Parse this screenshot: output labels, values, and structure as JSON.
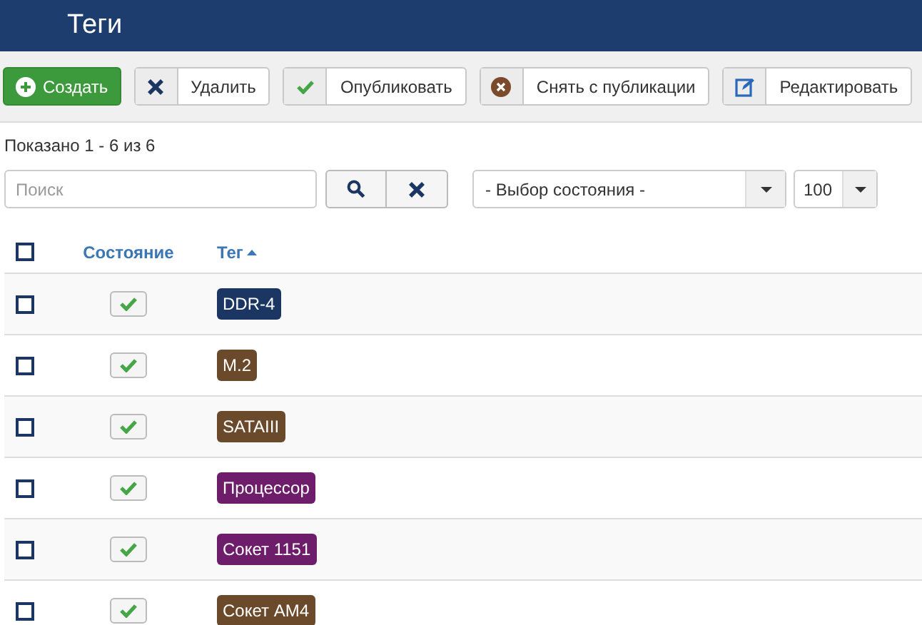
{
  "header": {
    "title": "Теги"
  },
  "toolbar": [
    {
      "kind": "create",
      "label": "Создать"
    },
    {
      "kind": "delete",
      "label": "Удалить"
    },
    {
      "kind": "publish",
      "label": "Опубликовать"
    },
    {
      "kind": "unpublish",
      "label": "Снять с публикации"
    },
    {
      "kind": "edit",
      "label": "Редактировать"
    }
  ],
  "count_text": "Показано 1 - 6 из 6",
  "search": {
    "placeholder": "Поиск"
  },
  "state_select": {
    "value": "- Выбор состояния -"
  },
  "limit_select": {
    "value": "100"
  },
  "table": {
    "columns": [
      {
        "label": "Состояние",
        "sorted": false
      },
      {
        "label": "Тег",
        "sorted": true
      }
    ],
    "select_all": {
      "checked": false
    },
    "rows": [
      {
        "checked": false,
        "published": true,
        "tag": "DDR-4",
        "color": "#1c3663"
      },
      {
        "checked": false,
        "published": true,
        "tag": "M.2",
        "color": "#6b4a2b"
      },
      {
        "checked": false,
        "published": true,
        "tag": "SATAIII",
        "color": "#6b4a2b"
      },
      {
        "checked": false,
        "published": true,
        "tag": "Процессор",
        "color": "#6e1d6b"
      },
      {
        "checked": false,
        "published": true,
        "tag": "Сокет 1151",
        "color": "#6e1d6b"
      },
      {
        "checked": false,
        "published": true,
        "tag": "Сокет AM4",
        "color": "#6b4a2b"
      }
    ]
  }
}
